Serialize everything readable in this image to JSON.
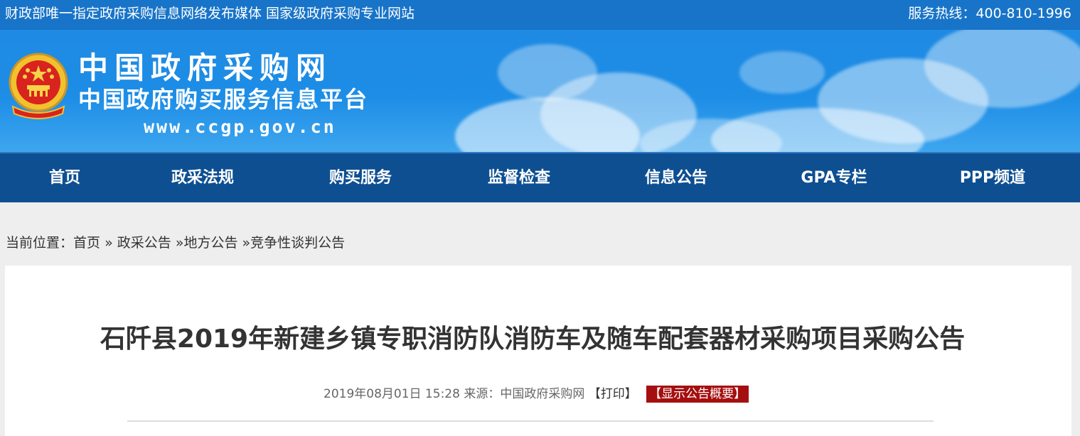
{
  "topbar": {
    "slogan": "财政部唯一指定政府采购信息网络发布媒体 国家级政府采购专业网站",
    "hotline": "服务热线：400-810-1996"
  },
  "banner": {
    "site_name": "中国政府采购网",
    "site_subtitle": "中国政府购买服务信息平台",
    "site_url": "www.ccgp.gov.cn",
    "emblem_icon": "national-emblem-icon"
  },
  "nav": {
    "items": [
      "首页",
      "政采法规",
      "购买服务",
      "监督检查",
      "信息公告",
      "GPA专栏",
      "PPP频道"
    ]
  },
  "breadcrumb": {
    "prefix": "当前位置：",
    "items": [
      "首页",
      "政采公告",
      "地方公告",
      "竞争性谈判公告"
    ],
    "separator": "»"
  },
  "article": {
    "title": "石阡县2019年新建乡镇专职消防队消防车及随车配套器材采购项目采购公告",
    "date": "2019年08月01日 15:28",
    "source_label": "来源：",
    "source": "中国政府采购网",
    "print_label": "【打印】",
    "summary_label": "【显示公告概要】"
  },
  "colors": {
    "topbar": "#1874c8",
    "nav": "#0e4f92",
    "summary_badge": "#a50f0f"
  }
}
